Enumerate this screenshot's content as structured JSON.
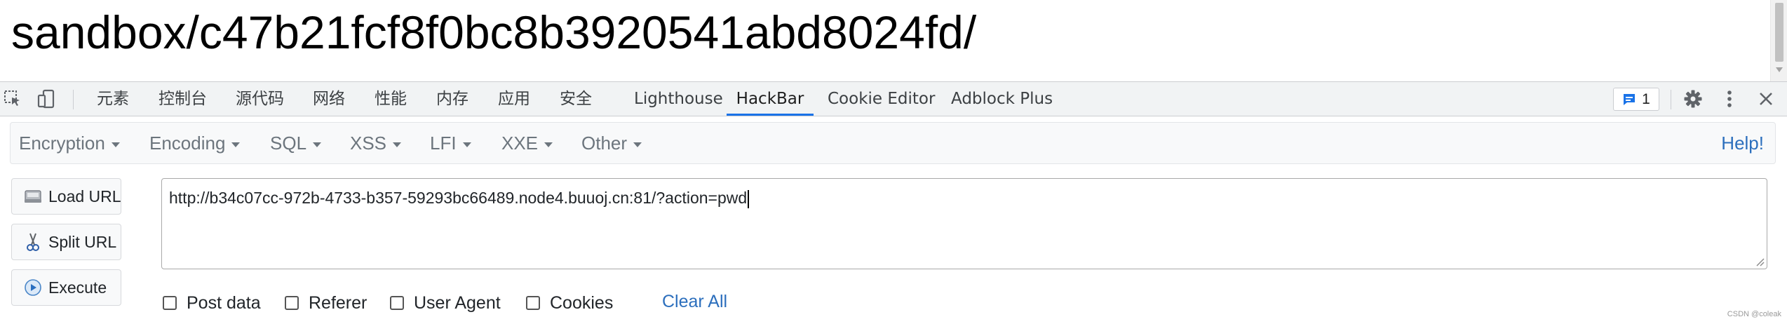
{
  "page": {
    "heading": "sandbox/c47b21fcf8f0bc8b3920541abd8024fd/"
  },
  "devtools": {
    "tabs": [
      {
        "label": "元素"
      },
      {
        "label": "控制台"
      },
      {
        "label": "源代码"
      },
      {
        "label": "网络"
      },
      {
        "label": "性能"
      },
      {
        "label": "内存"
      },
      {
        "label": "应用"
      },
      {
        "label": "安全"
      },
      {
        "label": "Lighthouse"
      },
      {
        "label": "HackBar"
      },
      {
        "label": "Cookie Editor"
      },
      {
        "label": "Adblock Plus"
      }
    ],
    "active_tab": "HackBar",
    "issues_count": "1",
    "accent_color": "#1a73e8",
    "icons": [
      "inspect-element-icon",
      "device-toolbar-icon",
      "issues-icon",
      "settings-gear-icon",
      "kebab-menu-icon",
      "close-icon"
    ]
  },
  "hackbar": {
    "menu": [
      {
        "label": "Encryption"
      },
      {
        "label": "Encoding"
      },
      {
        "label": "SQL"
      },
      {
        "label": "XSS"
      },
      {
        "label": "LFI"
      },
      {
        "label": "XXE"
      },
      {
        "label": "Other"
      }
    ],
    "help_label": "Help!",
    "buttons": {
      "load_url": "Load URL",
      "split_url": "Split URL",
      "execute": "Execute"
    },
    "url_value": "http://b34c07cc-972b-4733-b357-59293bc66489.node4.buuoj.cn:81/?action=pwd",
    "options": {
      "post_data": "Post data",
      "referer": "Referer",
      "user_agent": "User Agent",
      "cookies": "Cookies"
    },
    "clear_all": "Clear All",
    "link_color": "#2c6fbd"
  },
  "watermark": "CSDN @coleak"
}
